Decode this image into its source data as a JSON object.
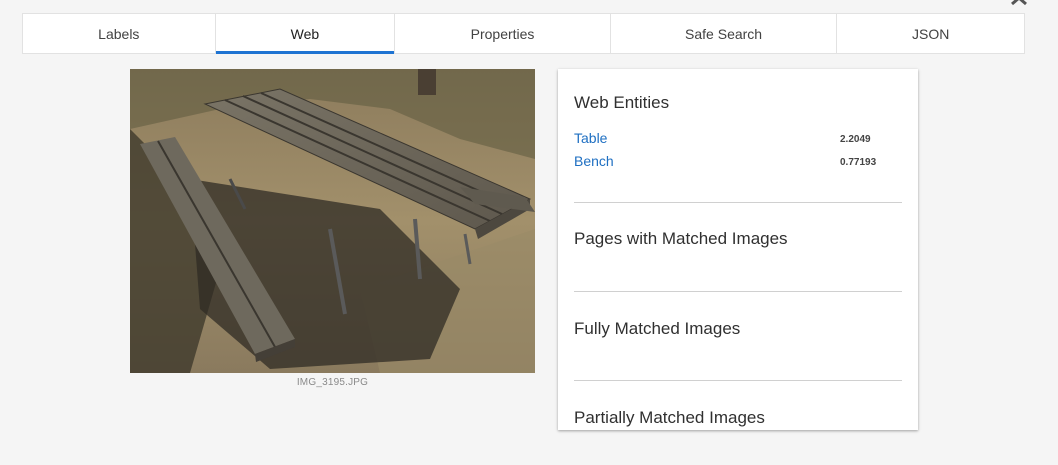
{
  "tabs": [
    {
      "label": "Labels",
      "active": false
    },
    {
      "label": "Web",
      "active": true
    },
    {
      "label": "Properties",
      "active": false
    },
    {
      "label": "Safe Search",
      "active": false
    },
    {
      "label": "JSON",
      "active": false
    }
  ],
  "image": {
    "caption": "IMG_3195.JPG",
    "subject": "wooden picnic table on dry grass"
  },
  "panel": {
    "web_entities_title": "Web Entities",
    "entities": [
      {
        "name": "Table",
        "score": "2.2049"
      },
      {
        "name": "Bench",
        "score": "0.77193"
      }
    ],
    "pages_title": "Pages with Matched Images",
    "full_title": "Fully Matched Images",
    "partial_title": "Partially Matched Images"
  },
  "colors": {
    "accent": "#1e73d2",
    "link": "#1e6fc2",
    "background": "#f5f5f5"
  },
  "icons": {
    "close": "close-icon"
  }
}
